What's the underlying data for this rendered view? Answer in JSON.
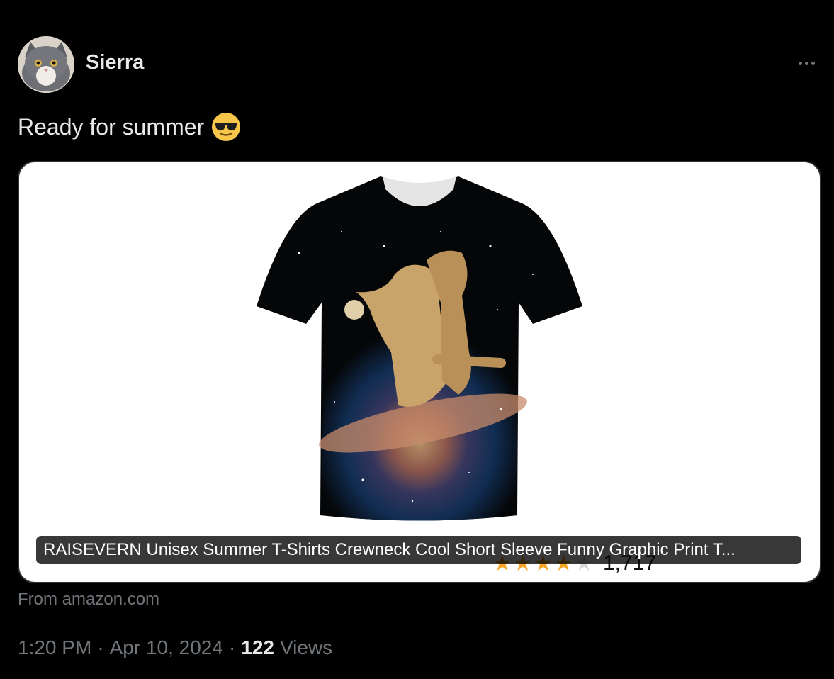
{
  "post": {
    "author": "Sierra",
    "avatar_icon": "cat-avatar-icon",
    "more_icon": "more-options-icon",
    "text": "Ready for summer",
    "emoji_icon": "smiling-face-with-sunglasses-icon"
  },
  "card": {
    "image_icon": "cat-tshirt-image",
    "rating": {
      "filled": 4,
      "total": 5,
      "count": "1,717"
    },
    "title": "RAISEVERN Unisex Summer T-Shirts Crewneck Cool Short Sleeve Funny Graphic Print T...",
    "source": "From amazon.com"
  },
  "meta": {
    "time": "1:20 PM",
    "separator": "·",
    "date": "Apr 10, 2024",
    "views_count": "122",
    "views_label": "Views"
  },
  "colors": {
    "background": "#000000",
    "text_primary": "#e7e9ea",
    "text_secondary": "#71767b",
    "star": "#f5a623"
  }
}
